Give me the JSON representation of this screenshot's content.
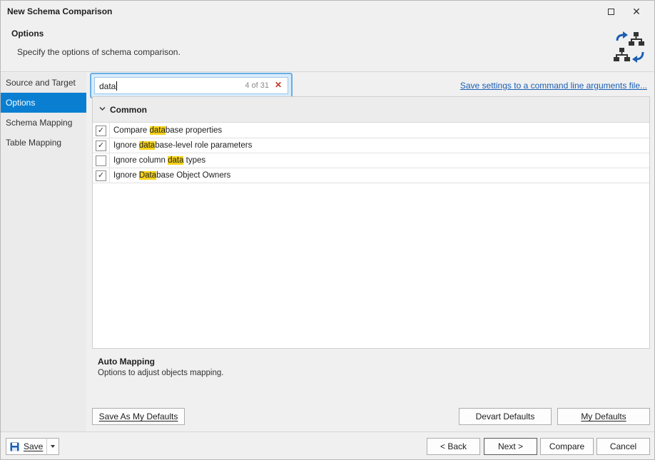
{
  "window": {
    "title": "New Schema Comparison",
    "accent_color": "#0a7fd2",
    "highlight_color": "#f5d21a"
  },
  "header": {
    "title": "Options",
    "subtitle": "Specify the options of schema comparison.",
    "icon": "schema-compare-icon"
  },
  "sidebar": {
    "items": [
      {
        "label": "Source and Target",
        "active": false
      },
      {
        "label": "Options",
        "active": true
      },
      {
        "label": "Schema Mapping",
        "active": false
      },
      {
        "label": "Table Mapping",
        "active": false
      }
    ]
  },
  "search": {
    "value": "data",
    "count": "4 of 31",
    "clear_icon": "clear-x-icon"
  },
  "save_settings_link": "Save settings to a command line arguments file...",
  "options": {
    "group_label": "Common",
    "items": [
      {
        "pre": "Compare ",
        "hl": "data",
        "post": "base properties",
        "checked": true
      },
      {
        "pre": "Ignore ",
        "hl": "data",
        "post": "base-level role parameters",
        "checked": true
      },
      {
        "pre": "Ignore column ",
        "hl": "data",
        "post": " types",
        "checked": false
      },
      {
        "pre": "Ignore ",
        "hl": "Data",
        "post": "base Object Owners",
        "checked": true
      }
    ]
  },
  "description": {
    "title": "Auto Mapping",
    "text": "Options to adjust objects mapping."
  },
  "buttons": {
    "save_as_defaults": "Save As My Defaults",
    "devart_defaults": "Devart Defaults",
    "my_defaults": "My Defaults",
    "save": "Save",
    "back": "< Back",
    "next": "Next >",
    "compare": "Compare",
    "cancel": "Cancel"
  }
}
